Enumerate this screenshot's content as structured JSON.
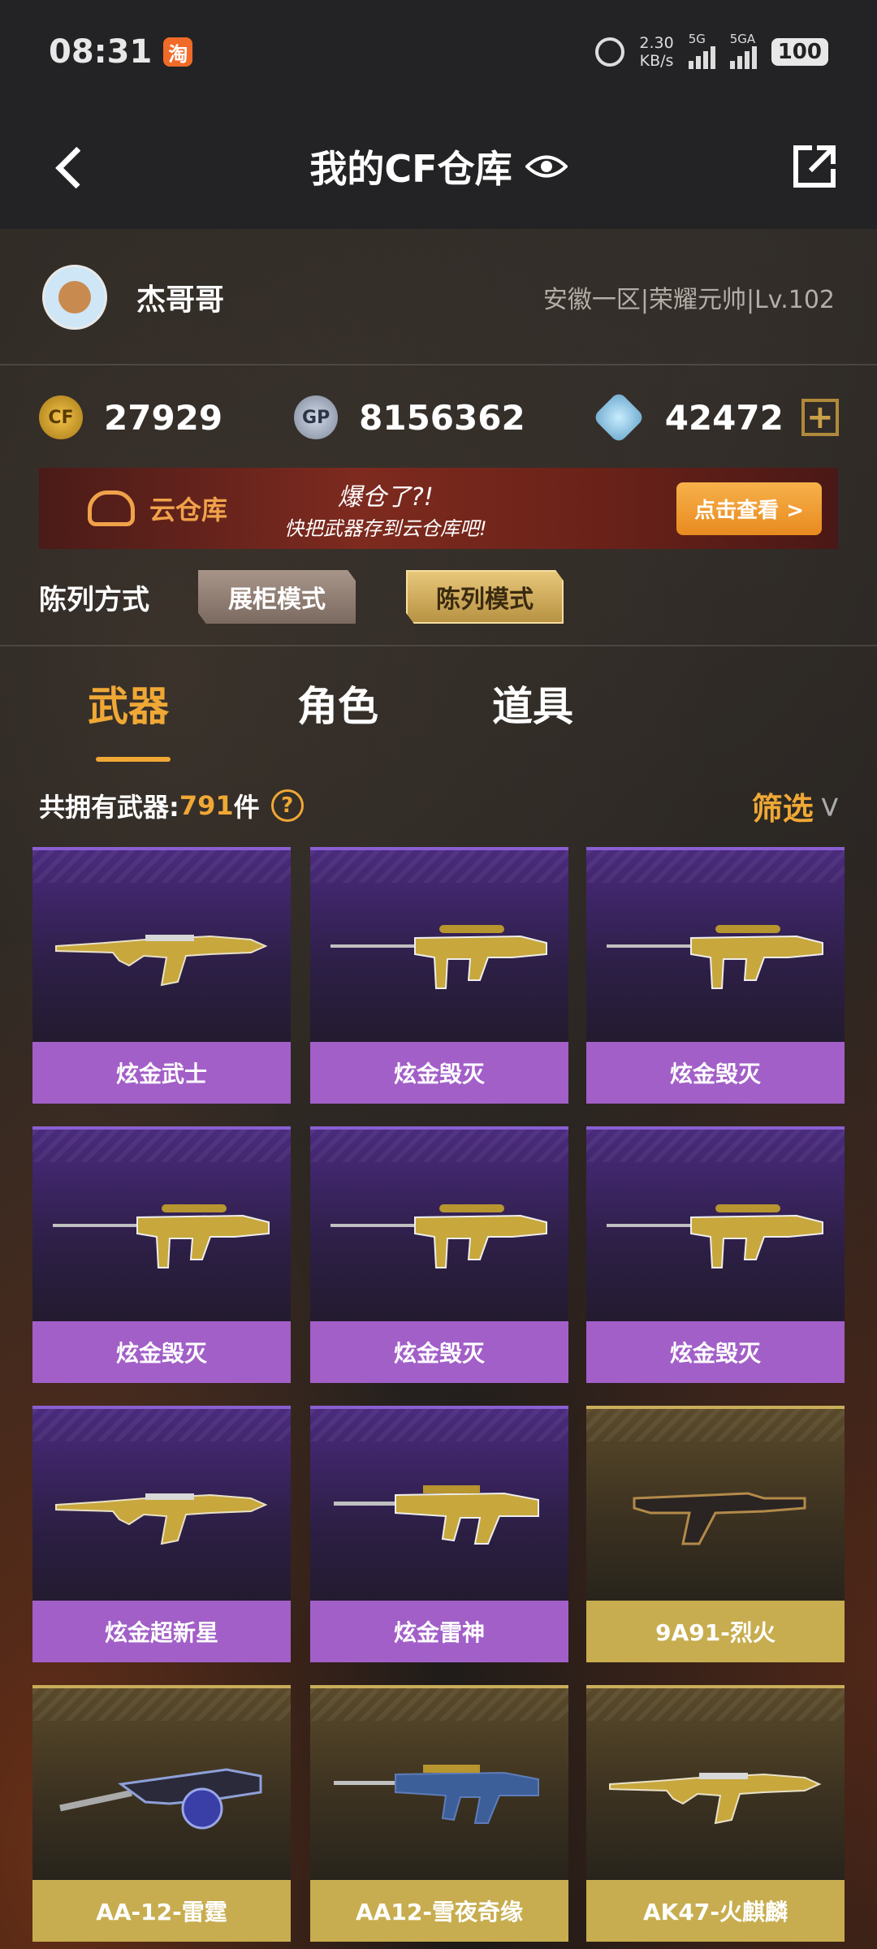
{
  "status_bar": {
    "time": "08:31",
    "app_icon": "淘",
    "net_speed_value": "2.30",
    "net_speed_unit": "KB/s",
    "signal1_label": "5G",
    "signal2_label": "5GA",
    "battery": "100"
  },
  "nav": {
    "title": "我的CF仓库"
  },
  "profile": {
    "username": "杰哥哥",
    "server_info": "安徽一区|荣耀元帅|Lv.102"
  },
  "currency": {
    "cf_points": "27929",
    "gp": "8156362",
    "gems": "42472",
    "gp_badge": "GP"
  },
  "banner": {
    "title": "云仓库",
    "slogan_line1": "爆仓了?!",
    "slogan_line2": "快把武器存到云仓库吧!",
    "button": "点击查看 >"
  },
  "display_mode": {
    "label": "陈列方式",
    "modes": [
      "展柜模式",
      "陈列模式"
    ]
  },
  "tabs": [
    "武器",
    "角色",
    "道具"
  ],
  "inventory": {
    "count_label": "共拥有武器:",
    "count_value": "791",
    "count_unit": "件",
    "help": "?",
    "filter_label": "筛选"
  },
  "weapons": [
    {
      "name": "炫金武士",
      "rarity": "purple",
      "icon": "ak-rifle-icon"
    },
    {
      "name": "炫金毁灭",
      "rarity": "purple",
      "icon": "sniper-rifle-icon"
    },
    {
      "name": "炫金毁灭",
      "rarity": "purple",
      "icon": "sniper-rifle-icon"
    },
    {
      "name": "炫金毁灭",
      "rarity": "purple",
      "icon": "sniper-rifle-icon"
    },
    {
      "name": "炫金毁灭",
      "rarity": "purple",
      "icon": "sniper-rifle-icon"
    },
    {
      "name": "炫金毁灭",
      "rarity": "purple",
      "icon": "sniper-rifle-icon"
    },
    {
      "name": "炫金超新星",
      "rarity": "purple",
      "icon": "ak-rifle-icon"
    },
    {
      "name": "炫金雷神",
      "rarity": "purple",
      "icon": "m4-rifle-icon"
    },
    {
      "name": "9A91-烈火",
      "rarity": "gold",
      "icon": "smg-icon"
    },
    {
      "name": "AA-12-雷霆",
      "rarity": "gold",
      "icon": "shotgun-icon"
    },
    {
      "name": "AA12-雪夜奇缘",
      "rarity": "gold",
      "icon": "m4-rifle-icon"
    },
    {
      "name": "AK47-火麒麟",
      "rarity": "gold",
      "icon": "ak-rifle-icon"
    }
  ],
  "colors": {
    "accent": "#f0a835",
    "purple_card": "#a25fc8",
    "gold_card": "#c7ad4f",
    "header_bg": "#232325"
  }
}
